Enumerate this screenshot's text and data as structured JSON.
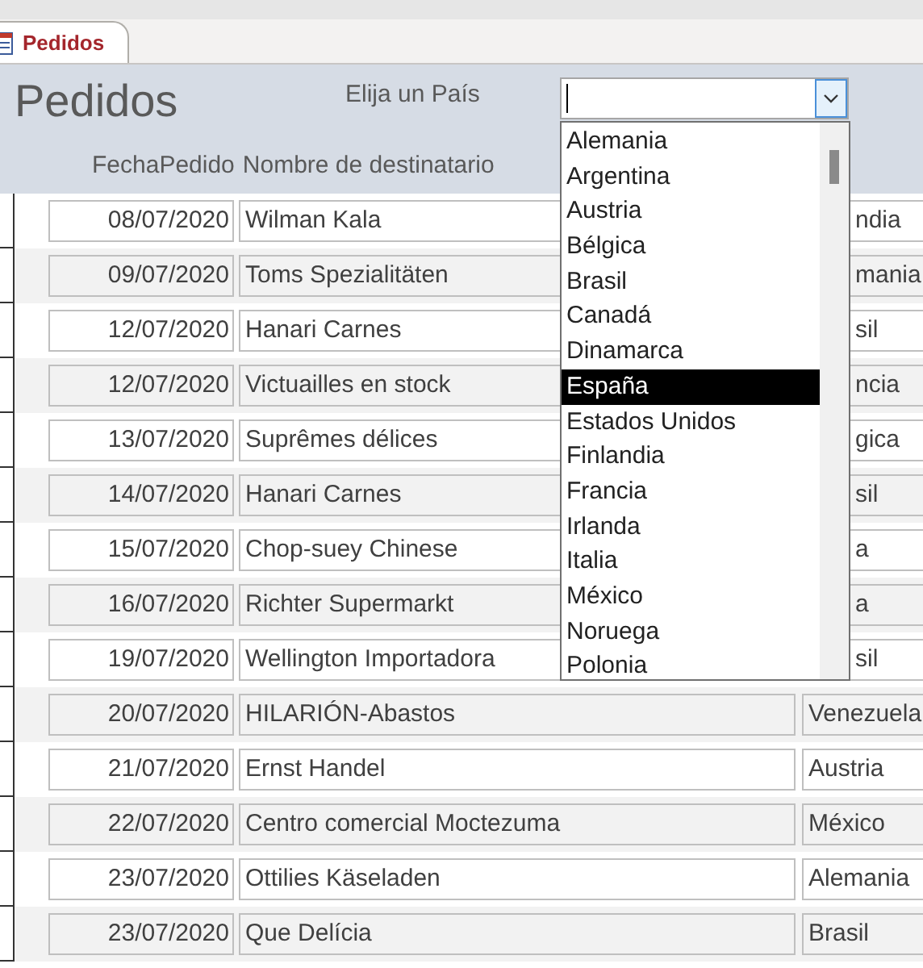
{
  "tabs": [
    {
      "label": "Pedidos",
      "selected": true
    }
  ],
  "form": {
    "title": "Pedidos",
    "filter_label": "Elija un País",
    "country_combo": {
      "expanded": true,
      "options": [
        {
          "label": "Alemania",
          "selected": false
        },
        {
          "label": "Argentina",
          "selected": false
        },
        {
          "label": "Austria",
          "selected": false
        },
        {
          "label": "Bélgica",
          "selected": false
        },
        {
          "label": "Brasil",
          "selected": false
        },
        {
          "label": "Canadá",
          "selected": false
        },
        {
          "label": "Dinamarca",
          "selected": false
        },
        {
          "label": "España",
          "selected": true
        },
        {
          "label": "Estados Unidos",
          "selected": false
        },
        {
          "label": "Finlandia",
          "selected": false
        },
        {
          "label": "Francia",
          "selected": false
        },
        {
          "label": "Irlanda",
          "selected": false
        },
        {
          "label": "Italia",
          "selected": false
        },
        {
          "label": "México",
          "selected": false
        },
        {
          "label": "Noruega",
          "selected": false
        },
        {
          "label": "Polonia",
          "selected": false
        }
      ]
    },
    "columns": [
      "FechaPedido",
      "Nombre de destinatario"
    ],
    "rows": [
      {
        "date": "08/07/2020",
        "recipient": "Wilman Kala",
        "country": "ndia"
      },
      {
        "date": "09/07/2020",
        "recipient": "Toms Spezialitäten",
        "country": "mania"
      },
      {
        "date": "12/07/2020",
        "recipient": "Hanari Carnes",
        "country": "sil"
      },
      {
        "date": "12/07/2020",
        "recipient": "Victuailles en stock",
        "country": "ncia"
      },
      {
        "date": "13/07/2020",
        "recipient": "Suprêmes délices",
        "country": "gica"
      },
      {
        "date": "14/07/2020",
        "recipient": "Hanari Carnes",
        "country": "sil"
      },
      {
        "date": "15/07/2020",
        "recipient": "Chop-suey Chinese",
        "country": "a"
      },
      {
        "date": "16/07/2020",
        "recipient": "Richter Supermarkt",
        "country": "a"
      },
      {
        "date": "19/07/2020",
        "recipient": "Wellington Importadora",
        "country": "sil"
      },
      {
        "date": "20/07/2020",
        "recipient": "HILARIÓN-Abastos",
        "country": "Venezuela"
      },
      {
        "date": "21/07/2020",
        "recipient": "Ernst Handel",
        "country": "Austria"
      },
      {
        "date": "22/07/2020",
        "recipient": "Centro comercial Moctezuma",
        "country": "México"
      },
      {
        "date": "23/07/2020",
        "recipient": "Ottilies Käseladen",
        "country": "Alemania"
      },
      {
        "date": "23/07/2020",
        "recipient": "Que Delícia",
        "country": "Brasil"
      }
    ]
  }
}
